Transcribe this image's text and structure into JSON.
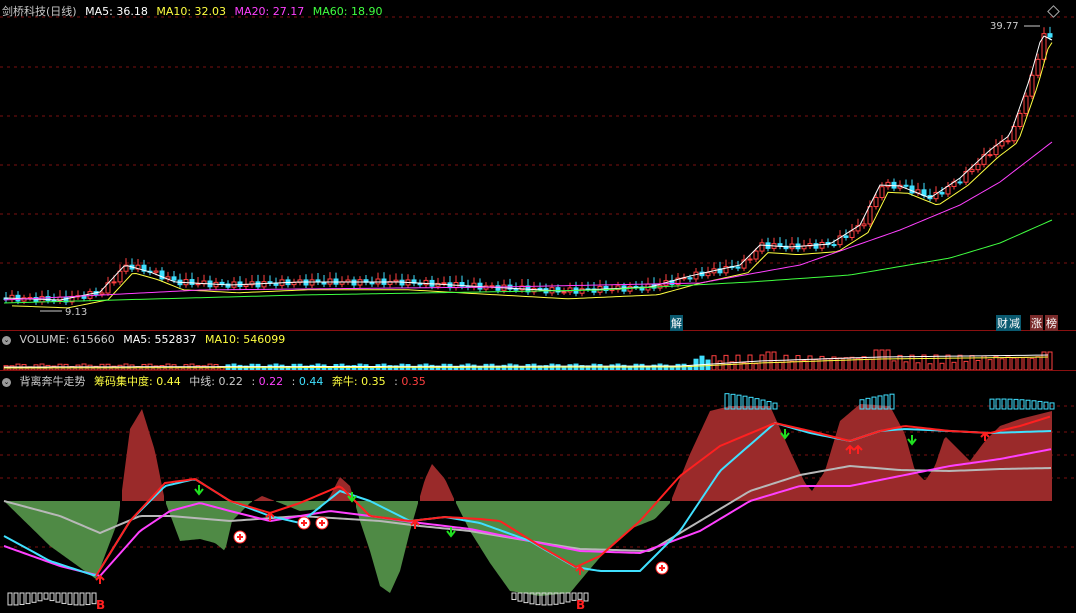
{
  "price_panel": {
    "stock_name": "剑桥科技(日线)",
    "ma5_label": "MA5:",
    "ma5_value": "36.18",
    "ma10_label": "MA10:",
    "ma10_value": "32.03",
    "ma20_label": "MA20:",
    "ma20_value": "27.17",
    "ma60_label": "MA60:",
    "ma60_value": "18.90",
    "high_label": "39.77",
    "low_label": "9.13",
    "jie_tag": "解",
    "cai_tag": "财",
    "jian_tag": "减",
    "zhang_tag": "涨",
    "bang_tag": "榜",
    "colors": {
      "ma5": "#ffffff",
      "ma10": "#ffff40",
      "ma20": "#ff40ff",
      "ma60": "#40ff40"
    }
  },
  "volume_panel": {
    "volume_label": "VOLUME:",
    "volume_value": "615660",
    "ma5_label": "MA5:",
    "ma5_value": "552837",
    "ma10_label": "MA10:",
    "ma10_value": "546099"
  },
  "indicator_panel": {
    "name": "背离奔牛走势",
    "chip_label": "筹码集中度:",
    "chip_value": "0.44",
    "mid_label": "中线:",
    "mid_value": "0.22",
    "sep1": ":",
    "v2": "0.22",
    "sep2": ":",
    "v3": "0.44",
    "bull_label": "奔牛:",
    "bull_value": "0.35",
    "sep3": ":",
    "v4": "0.35",
    "b_marker_1": "B",
    "b_marker_2": "B"
  }
}
